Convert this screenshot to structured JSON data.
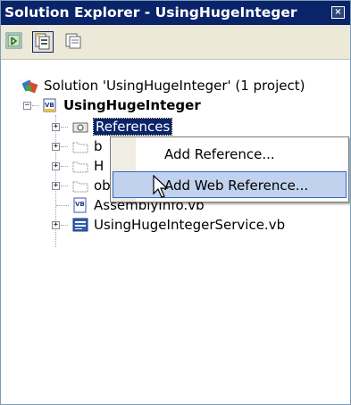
{
  "window": {
    "title": "Solution Explorer - UsingHugeInteger",
    "close_glyph": "×"
  },
  "toolbar": {
    "buttons": [
      {
        "icon": "properties-icon",
        "pressed": false
      },
      {
        "icon": "show-all-files-icon",
        "pressed": true
      },
      {
        "icon": "refresh-icon",
        "pressed": false
      }
    ]
  },
  "tree": {
    "solution_label": "Solution 'UsingHugeInteger' (1 project)",
    "project_label": "UsingHugeInteger",
    "references_label": "References",
    "bin_label": "b",
    "hidden_label": "H",
    "obj_label": "obj",
    "assemblyinfo_label": "AssemblyInfo.vb",
    "service_label": "UsingHugeIntegerService.vb"
  },
  "context_menu": {
    "items": [
      {
        "label": "Add Reference...",
        "hover": false
      },
      {
        "label": "Add Web Reference...",
        "hover": true
      }
    ]
  },
  "colors": {
    "title_bg": "#0a246a",
    "selection_bg": "#0a246a",
    "menu_hover_bg": "#c1d2ee",
    "menu_hover_border": "#316ac5",
    "toolbar_bg": "#ece9d8"
  }
}
